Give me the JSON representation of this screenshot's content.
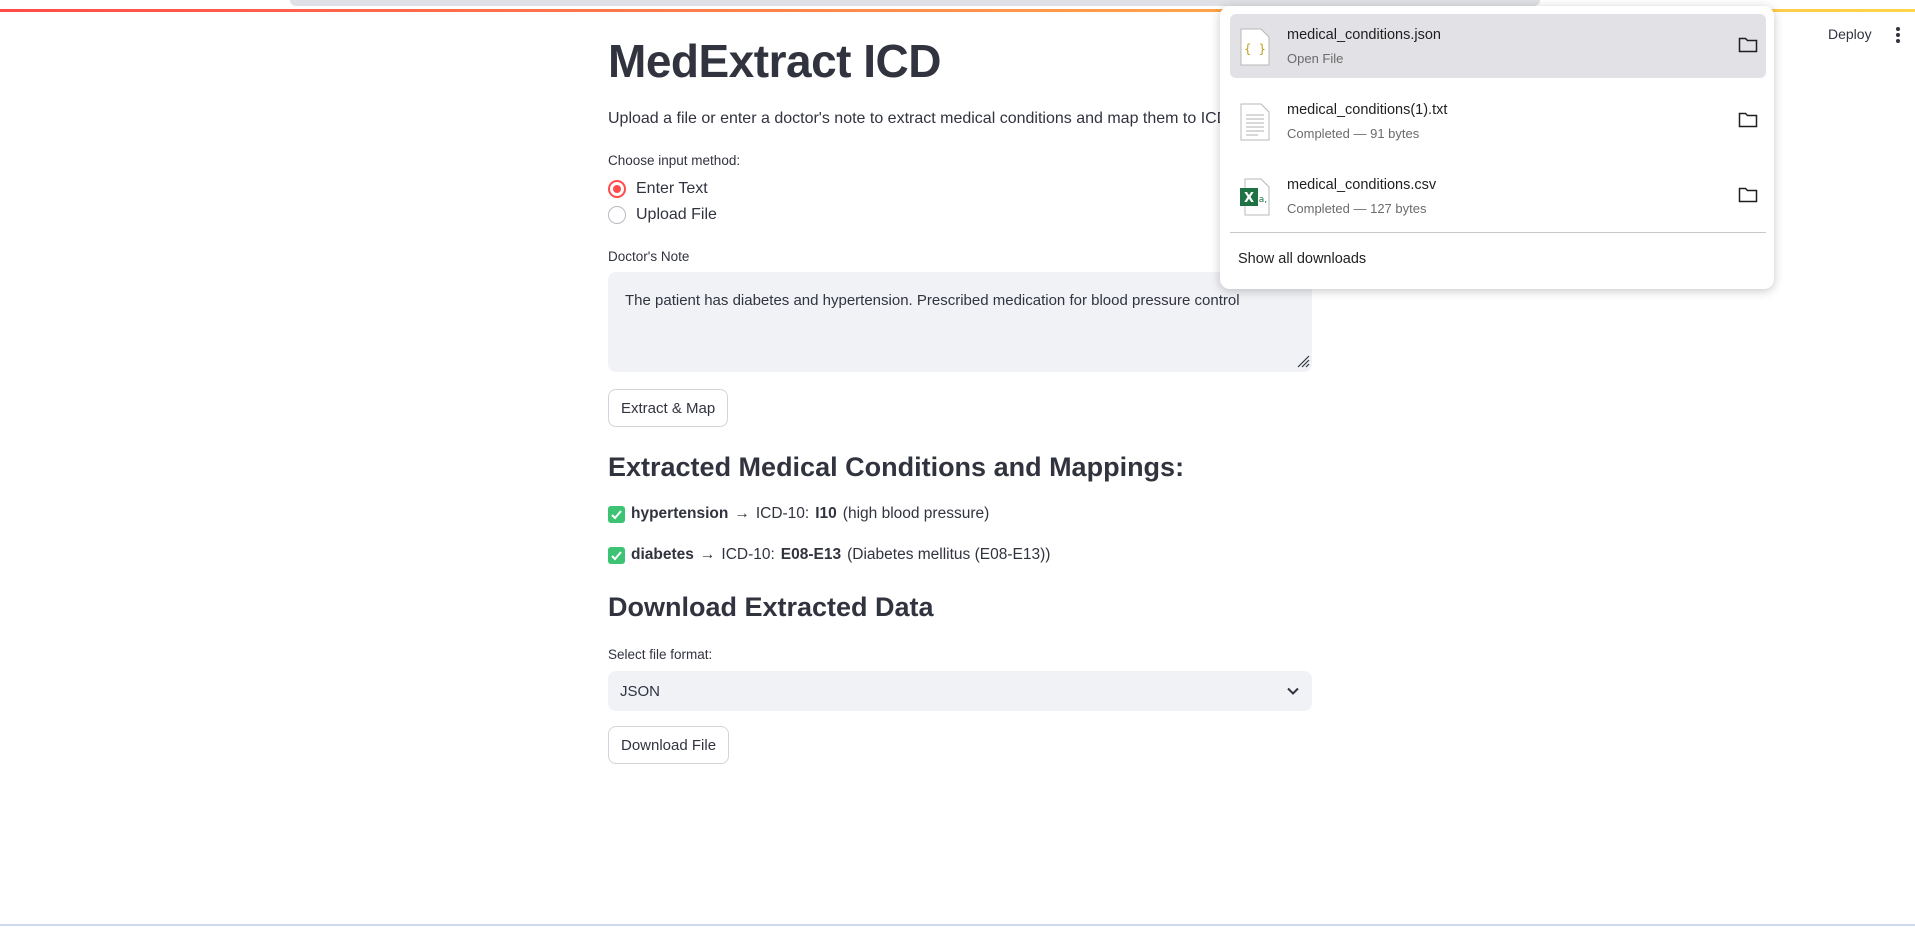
{
  "header": {
    "deploy_label": "Deploy"
  },
  "main": {
    "title": "MedExtract ICD",
    "subtitle": "Upload a file or enter a doctor's note to extract medical conditions and map them to ICD-10 c",
    "input_method_label": "Choose input method:",
    "input_options": [
      "Enter Text",
      "Upload File"
    ],
    "selected_option": "Enter Text",
    "note_label": "Doctor's Note",
    "note_value": "The patient has diabetes and hypertension. Prescribed medication for blood pressure control",
    "extract_button": "Extract & Map",
    "results_heading": "Extracted Medical Conditions and Mappings:",
    "results": [
      {
        "condition": "hypertension",
        "arrow": "→",
        "prefix": "ICD-10:",
        "code": "I10",
        "description": "(high blood pressure)"
      },
      {
        "condition": "diabetes",
        "arrow": "→",
        "prefix": "ICD-10:",
        "code": "E08-E13",
        "description": "(Diabetes mellitus (E08-E13))"
      }
    ],
    "download_heading": "Download Extracted Data",
    "format_label": "Select file format:",
    "format_value": "JSON",
    "download_button": "Download File"
  },
  "downloads": {
    "items": [
      {
        "name": "medical_conditions.json",
        "status": "Open File",
        "icon": "json-file-icon"
      },
      {
        "name": "medical_conditions(1).txt",
        "status": "Completed — 91 bytes",
        "icon": "text-file-icon"
      },
      {
        "name": "medical_conditions.csv",
        "status": "Completed — 127 bytes",
        "icon": "excel-file-icon"
      }
    ],
    "show_all": "Show all downloads"
  },
  "colors": {
    "accent": "#ff4b4b",
    "success": "#3cc374",
    "input_bg": "#f0f2f6",
    "text": "#31333f"
  }
}
